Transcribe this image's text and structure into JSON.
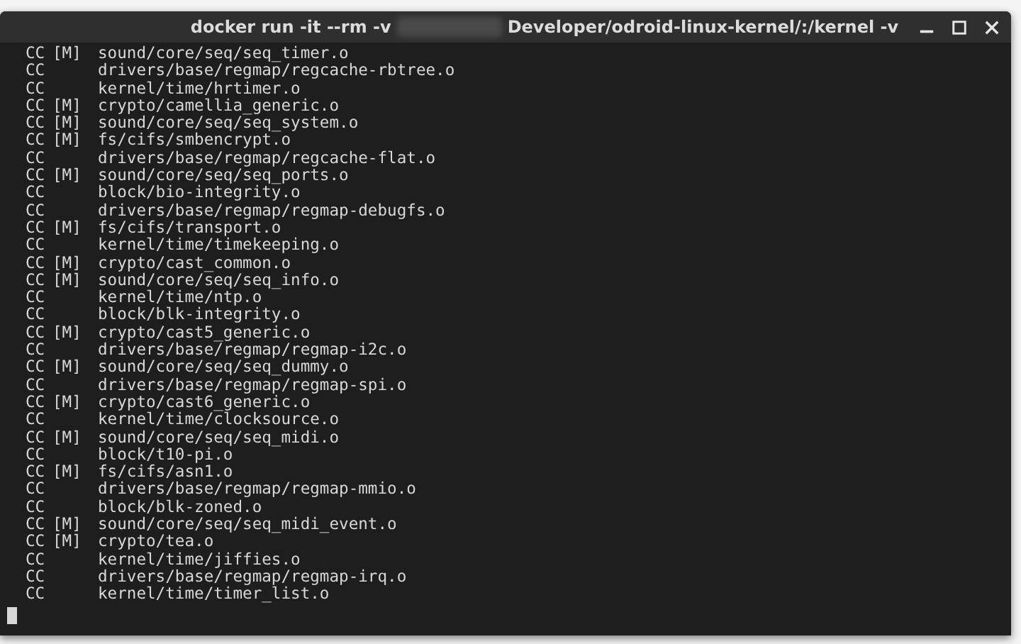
{
  "window": {
    "title_before": "docker run -it --rm -v",
    "title_after": "Developer/odroid-linux-kernel/:/kernel -v"
  },
  "lines": [
    {
      "cmd": "CC",
      "tag": "[M]",
      "path": "sound/core/seq/seq_timer.o"
    },
    {
      "cmd": "CC",
      "path": "drivers/base/regmap/regcache-rbtree.o"
    },
    {
      "cmd": "CC",
      "path": "kernel/time/hrtimer.o"
    },
    {
      "cmd": "CC",
      "tag": "[M]",
      "path": "crypto/camellia_generic.o"
    },
    {
      "cmd": "CC",
      "tag": "[M]",
      "path": "sound/core/seq/seq_system.o"
    },
    {
      "cmd": "CC",
      "tag": "[M]",
      "path": "fs/cifs/smbencrypt.o"
    },
    {
      "cmd": "CC",
      "path": "drivers/base/regmap/regcache-flat.o"
    },
    {
      "cmd": "CC",
      "tag": "[M]",
      "path": "sound/core/seq/seq_ports.o"
    },
    {
      "cmd": "CC",
      "path": "block/bio-integrity.o"
    },
    {
      "cmd": "CC",
      "path": "drivers/base/regmap/regmap-debugfs.o"
    },
    {
      "cmd": "CC",
      "tag": "[M]",
      "path": "fs/cifs/transport.o"
    },
    {
      "cmd": "CC",
      "path": "kernel/time/timekeeping.o"
    },
    {
      "cmd": "CC",
      "tag": "[M]",
      "path": "crypto/cast_common.o"
    },
    {
      "cmd": "CC",
      "tag": "[M]",
      "path": "sound/core/seq/seq_info.o"
    },
    {
      "cmd": "CC",
      "path": "kernel/time/ntp.o"
    },
    {
      "cmd": "CC",
      "path": "block/blk-integrity.o"
    },
    {
      "cmd": "CC",
      "tag": "[M]",
      "path": "crypto/cast5_generic.o"
    },
    {
      "cmd": "CC",
      "path": "drivers/base/regmap/regmap-i2c.o"
    },
    {
      "cmd": "CC",
      "tag": "[M]",
      "path": "sound/core/seq/seq_dummy.o"
    },
    {
      "cmd": "CC",
      "path": "drivers/base/regmap/regmap-spi.o"
    },
    {
      "cmd": "CC",
      "tag": "[M]",
      "path": "crypto/cast6_generic.o"
    },
    {
      "cmd": "CC",
      "path": "kernel/time/clocksource.o"
    },
    {
      "cmd": "CC",
      "tag": "[M]",
      "path": "sound/core/seq/seq_midi.o"
    },
    {
      "cmd": "CC",
      "path": "block/t10-pi.o"
    },
    {
      "cmd": "CC",
      "tag": "[M]",
      "path": "fs/cifs/asn1.o"
    },
    {
      "cmd": "CC",
      "path": "drivers/base/regmap/regmap-mmio.o"
    },
    {
      "cmd": "CC",
      "path": "block/blk-zoned.o"
    },
    {
      "cmd": "CC",
      "tag": "[M]",
      "path": "sound/core/seq/seq_midi_event.o"
    },
    {
      "cmd": "CC",
      "tag": "[M]",
      "path": "crypto/tea.o"
    },
    {
      "cmd": "CC",
      "path": "kernel/time/jiffies.o"
    },
    {
      "cmd": "CC",
      "path": "drivers/base/regmap/regmap-irq.o"
    },
    {
      "cmd": "CC",
      "path": "kernel/time/timer_list.o"
    }
  ]
}
